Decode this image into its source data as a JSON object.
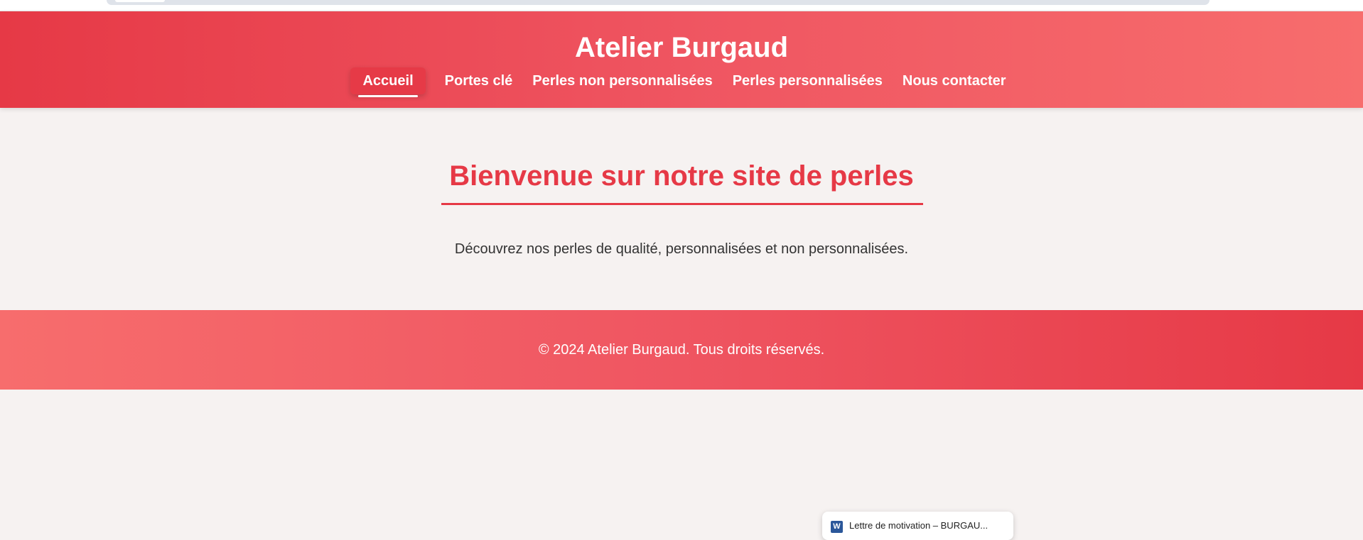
{
  "colors": {
    "accent": "#e63946",
    "accent_light": "#f76d6d",
    "background": "#f6f2f1",
    "text": "#333333"
  },
  "header": {
    "title": "Atelier Burgaud",
    "nav": [
      {
        "label": "Accueil",
        "active": true
      },
      {
        "label": "Portes clé",
        "active": false
      },
      {
        "label": "Perles non personnalisées",
        "active": false
      },
      {
        "label": "Perles personnalisées",
        "active": false
      },
      {
        "label": "Nous contacter",
        "active": false
      }
    ]
  },
  "main": {
    "heading": "Bienvenue sur notre site de perles",
    "intro": "Découvrez nos perles de qualité, personnalisées et non personnalisées."
  },
  "footer": {
    "copyright": "© 2024 Atelier Burgaud. Tous droits réservés."
  },
  "download": {
    "icon": "word-document-icon",
    "icon_letter": "W",
    "filename": "Lettre de motivation – BURGAU..."
  }
}
